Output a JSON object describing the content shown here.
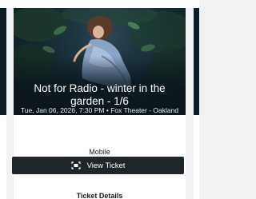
{
  "event": {
    "title": "Not for Radio - winter in the garden - 1/6",
    "meta": "Tue, Jan 06, 2026, 7:30 PM • Fox Theater - Oakland"
  },
  "ticket": {
    "delivery_type": "Mobile",
    "view_ticket_label": "View Ticket",
    "details_label": "Ticket Details"
  },
  "icons": {
    "view_ticket": "ticket-scan-icon"
  },
  "colors": {
    "button_bg": "#1f262a",
    "hero_bg": "#0f1c24",
    "page_bg": "#f2f2f4"
  }
}
